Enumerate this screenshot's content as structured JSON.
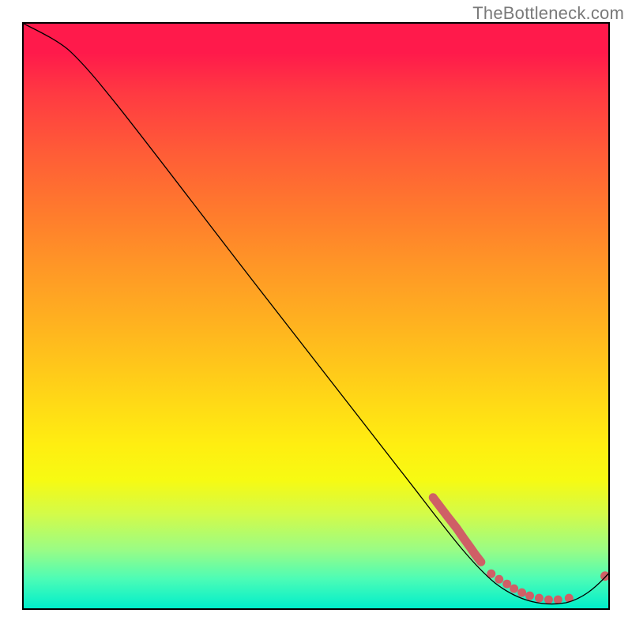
{
  "watermark": "TheBottleneck.com",
  "chart_data": {
    "type": "line",
    "title": "",
    "xlabel": "",
    "ylabel": "",
    "xlim": [
      0,
      100
    ],
    "ylim": [
      0,
      100
    ],
    "grid": false,
    "legend": false,
    "series": [
      {
        "name": "bottleneck-curve",
        "x": [
          0,
          4,
          8,
          12,
          16,
          20,
          25,
          30,
          35,
          40,
          45,
          50,
          55,
          60,
          65,
          70,
          74,
          78,
          82,
          85,
          88,
          90,
          92,
          94,
          96,
          98,
          100
        ],
        "values": [
          100,
          98.5,
          96.5,
          93.5,
          89,
          84,
          77.5,
          71,
          64.5,
          58,
          51.5,
          45,
          38.5,
          32,
          25.5,
          19,
          14,
          9.5,
          5.5,
          3,
          1.3,
          0.7,
          0.3,
          0.5,
          1.5,
          3.2,
          5.5
        ],
        "color": "#000000"
      }
    ],
    "markers": [
      {
        "name": "segment-start",
        "x_range": [
          70,
          78
        ],
        "note": "salmon thick segment on descending slope"
      },
      {
        "name": "floor-dots",
        "x_range": [
          80,
          94
        ],
        "note": "salmon dot cluster at trough"
      },
      {
        "name": "rise-dot",
        "x": 100,
        "y": 5.5,
        "note": "salmon endpoint on ascending tail"
      }
    ],
    "background": {
      "type": "vertical-gradient",
      "stops": [
        {
          "pos": 0.0,
          "color": "#ff1a4b"
        },
        {
          "pos": 0.5,
          "color": "#ffb41f"
        },
        {
          "pos": 0.78,
          "color": "#f7fa12"
        },
        {
          "pos": 1.0,
          "color": "#00eecb"
        }
      ]
    }
  }
}
